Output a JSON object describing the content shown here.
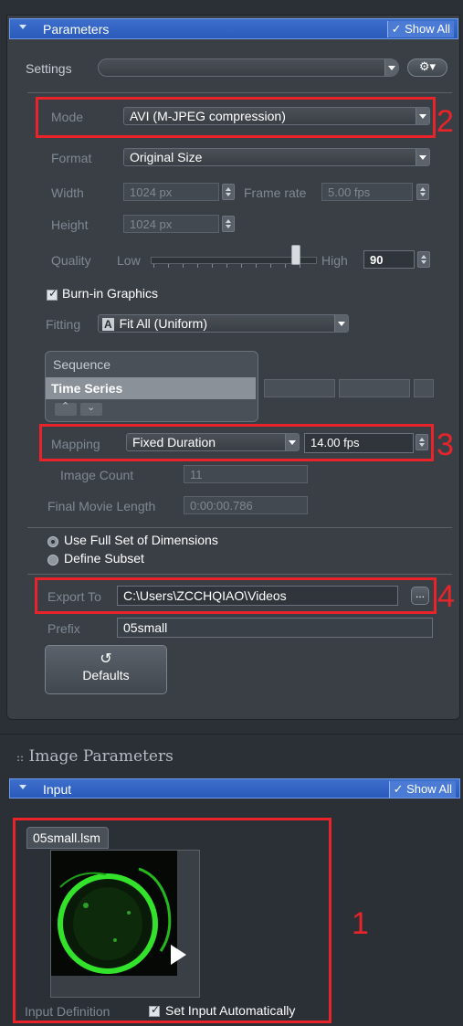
{
  "parameters": {
    "header_title": "Parameters",
    "show_all": "✓ Show All",
    "settings_label": "Settings",
    "settings_value": ""
  },
  "mode": {
    "label": "Mode",
    "value": "AVI (M-JPEG compression)"
  },
  "format": {
    "label": "Format",
    "value": "Original Size"
  },
  "width": {
    "label": "Width",
    "value": "1024 px"
  },
  "frame_rate": {
    "label": "Frame rate",
    "value": "5.00 fps"
  },
  "height": {
    "label": "Height",
    "value": "1024 px"
  },
  "quality": {
    "label": "Quality",
    "low": "Low",
    "high": "High",
    "value": "90",
    "level": 0.9
  },
  "burn_in": {
    "label": "Burn-in Graphics",
    "checked": true
  },
  "fitting": {
    "label": "Fitting",
    "value": "Fit All (Uniform)",
    "icon": "A"
  },
  "sequence": {
    "items": [
      "Sequence",
      "Time Series"
    ]
  },
  "mapping": {
    "label": "Mapping",
    "value": "Fixed Duration",
    "fps": "14.00 fps"
  },
  "image_count": {
    "label": "Image Count",
    "value": "11"
  },
  "final_length": {
    "label": "Final Movie Length",
    "value": "0:00:00.786"
  },
  "dimensions": {
    "use_full": "Use Full Set of Dimensions",
    "define_subset": "Define Subset",
    "selected": "use_full"
  },
  "export": {
    "label": "Export To",
    "value": "C:\\Users\\ZCCHQIAO\\Videos",
    "browse": "..."
  },
  "prefix": {
    "label": "Prefix",
    "value": "05small"
  },
  "defaults": {
    "icon": "↺",
    "label": "Defaults"
  },
  "image_parameters": {
    "title": "Image Parameters",
    "icon": "::"
  },
  "input": {
    "header_title": "Input",
    "show_all": "✓ Show All",
    "file_name": "05small.lsm",
    "definition_label": "Input Definition",
    "set_auto_label": "Set Input Automatically",
    "set_auto_checked": true
  },
  "annotations": [
    "1",
    "2",
    "3",
    "4"
  ],
  "colors": {
    "header_blue": "#2a5abb",
    "annotation_red": "#e8242a",
    "panel": "#3a3f46"
  }
}
